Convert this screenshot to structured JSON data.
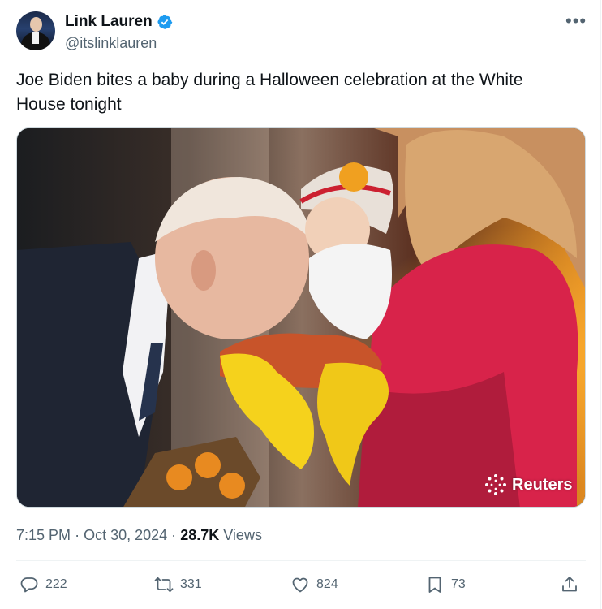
{
  "author": {
    "display_name": "Link Lauren",
    "handle": "@itslinklauren",
    "verified_icon": "verified-badge-icon"
  },
  "tweet": {
    "text": "Joe Biden bites a baby during a Halloween celebration at the White House tonight",
    "media_watermark": "Reuters"
  },
  "meta": {
    "time": "7:15 PM",
    "separator": "·",
    "date": "Oct 30, 2024",
    "views_count": "28.7K",
    "views_label": "Views"
  },
  "actions": {
    "replies": "222",
    "reposts": "331",
    "likes": "824",
    "bookmarks": "73"
  },
  "colors": {
    "verified": "#1d9bf0",
    "muted_text": "#536471",
    "primary_text": "#0f1419"
  }
}
